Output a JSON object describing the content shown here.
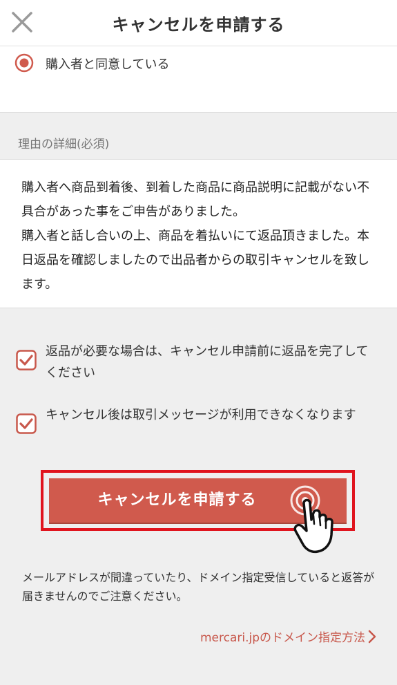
{
  "header": {
    "title": "キャンセルを申請する",
    "close_icon": "close-icon"
  },
  "reason_option": {
    "label": "購入者と同意している",
    "selected": true,
    "accent": "#d05a4d"
  },
  "details": {
    "section_label": "理由の詳細(必須)",
    "text": "購入者へ商品到着後、到着した商品に商品説明に記載がない不具合があった事をご申告がありました。\n購入者と話し合いの上、商品を着払いにて返品頂きました。本日返品を確認しましたので出品者からの取引キャンセルを致します。"
  },
  "checkboxes": [
    {
      "label": "返品が必要な場合は、キャンセル申請前に返品を完了してください",
      "checked": true
    },
    {
      "label": "キャンセル後は取引メッセージが利用できなくなります",
      "checked": true
    }
  ],
  "submit": {
    "label": "キャンセルを申請する",
    "color": "#d05a4d",
    "highlight_color": "#e0141e"
  },
  "notice": "メールアドレスが間違っていたり、ドメイン指定受信していると返答が届きませんのでご注意ください。",
  "domain_link": {
    "label": "mercari.jpのドメイン指定方法",
    "icon": "chevron-right-icon",
    "color": "#c8584c"
  }
}
